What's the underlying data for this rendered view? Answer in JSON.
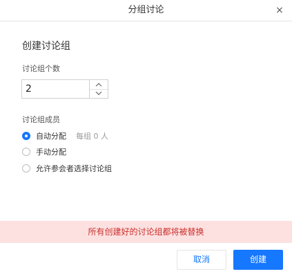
{
  "dialog": {
    "title": "分组讨论",
    "close_glyph": "×"
  },
  "form": {
    "section_title": "创建讨论组",
    "count_label": "讨论组个数",
    "count_value": "2",
    "members_label": "讨论组成员",
    "options": [
      {
        "label": "自动分配",
        "hint": "每组 0 人",
        "checked": true
      },
      {
        "label": "手动分配",
        "checked": false
      },
      {
        "label": "允许参会者选择讨论组",
        "checked": false
      }
    ]
  },
  "warning": {
    "text": "所有创建好的讨论组都将被替换"
  },
  "buttons": {
    "cancel_label": "取消",
    "create_label": "创建"
  },
  "colors": {
    "accent": "#1677ff",
    "warning_bg": "#fde1e1",
    "warning_text": "#c9302c"
  }
}
